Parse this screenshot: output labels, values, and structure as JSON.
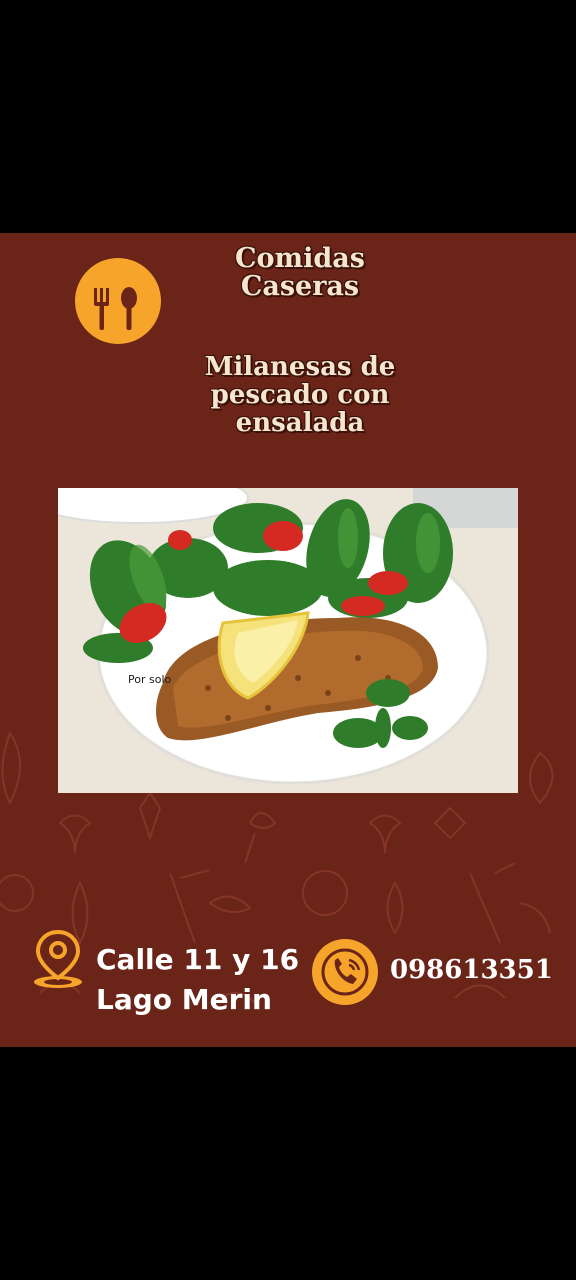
{
  "brand": {
    "title_line1": "Comidas",
    "title_line2": "Caseras",
    "icon": "fork-spoon-icon"
  },
  "dish": {
    "line1": "Milanesas de",
    "line2": "pescado con",
    "line3": "ensalada",
    "photo_caption": "Por solo"
  },
  "contact": {
    "location_icon": "location-pin-icon",
    "address_line1": "Calle 11 y 16",
    "address_line2": "Lago Merin",
    "phone_icon": "phone-icon",
    "phone": "098613351"
  },
  "colors": {
    "background": "#6a2418",
    "accent": "#f6a52a",
    "title_text": "#f5e6cf",
    "contact_text": "#ffffff",
    "letterbox": "#000000"
  }
}
